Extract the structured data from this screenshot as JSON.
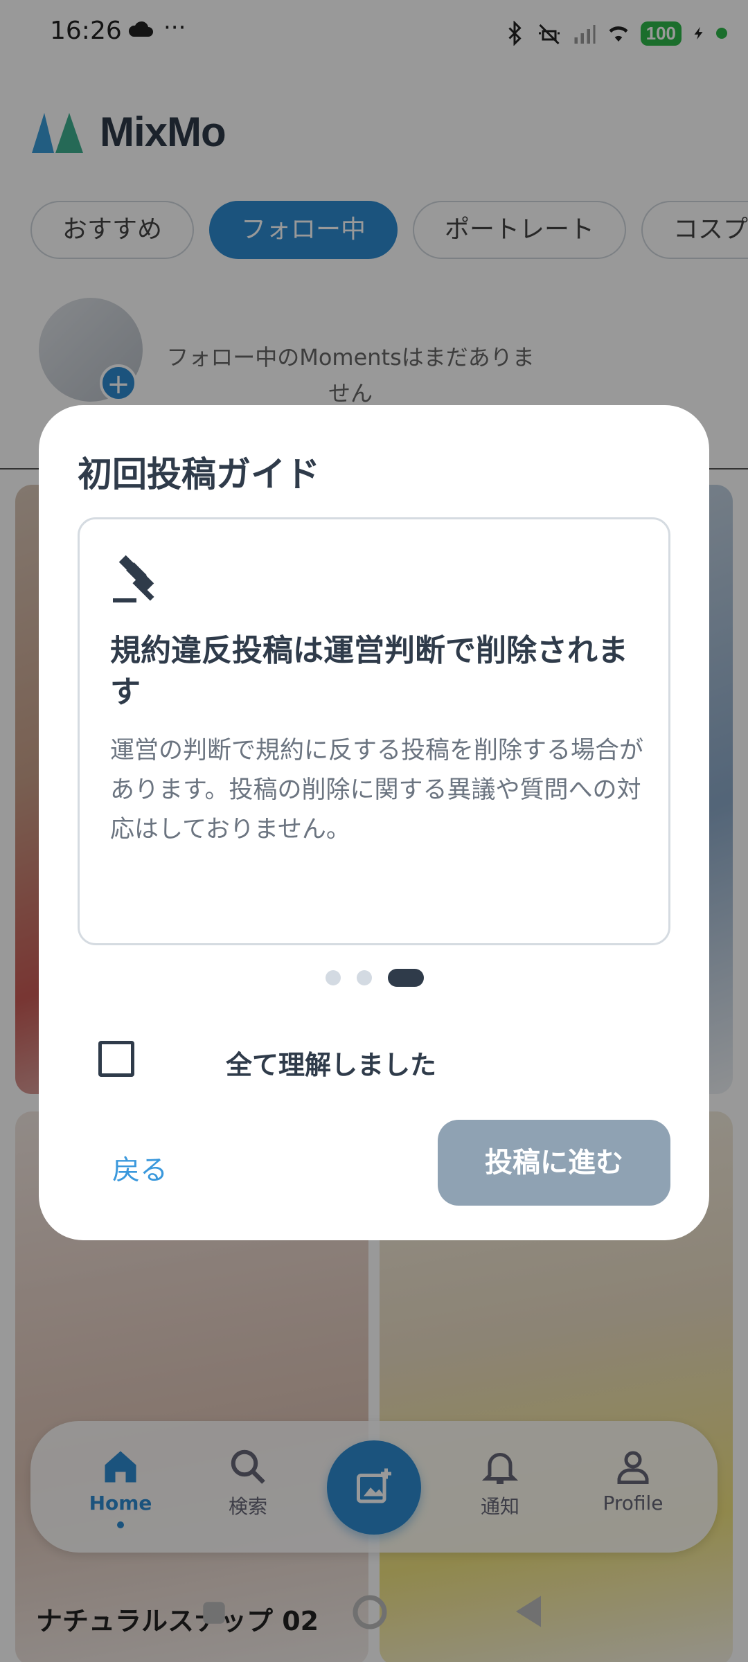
{
  "status_bar": {
    "time": "16:26",
    "overflow": "···",
    "battery": "100",
    "icons": [
      "cloud-icon",
      "bluetooth-icon",
      "vibrate-off-icon",
      "signal-icon",
      "wifi-icon",
      "charging-icon"
    ]
  },
  "header": {
    "brand": "MixMo"
  },
  "chips": [
    "おすすめ",
    "フォロー中",
    "ポートレート",
    "コスプ"
  ],
  "moments": {
    "empty_text": "フォロー中のMomentsはまだありません"
  },
  "feed": {
    "caption": "ナチュラルスナップ 02"
  },
  "bottom_nav": {
    "home": "Home",
    "search": "検索",
    "notice": "通知",
    "profile": "Profile"
  },
  "modal": {
    "title": "初回投稿ガイド",
    "card": {
      "icon": "gavel-icon",
      "heading": "規約違反投稿は運営判断で削除されます",
      "body": "運営の判断で規約に反する投稿を削除する場合があります。投稿の削除に関する異議や質問への対応はしておりません。"
    },
    "pager": {
      "pages": 3,
      "current": 3
    },
    "agree_label": "全て理解しました",
    "agree_checked": false,
    "back_label": "戻る",
    "proceed_label": "投稿に進む"
  },
  "colors": {
    "accent": "#2d8bd1",
    "text_dark": "#2f3b4a",
    "disabled_button": "#8fa2b3",
    "link": "#3a98dc"
  }
}
